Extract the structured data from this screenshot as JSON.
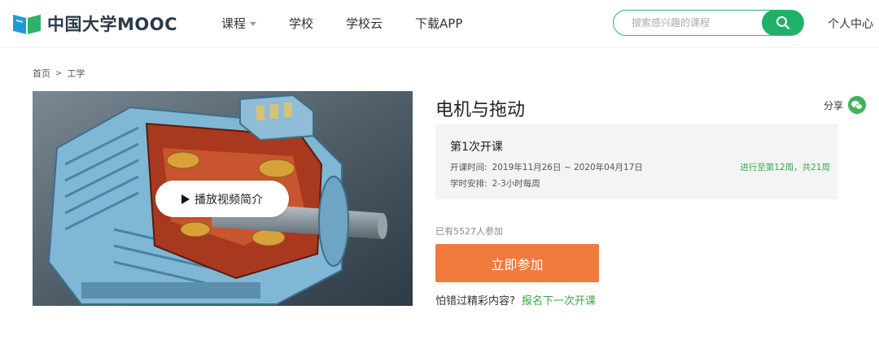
{
  "header": {
    "logo_text": "中国大学MOOC",
    "nav": [
      {
        "label": "课程",
        "has_dropdown": true
      },
      {
        "label": "学校"
      },
      {
        "label": "学校云"
      },
      {
        "label": "下载APP"
      }
    ],
    "search_placeholder": "搜索感兴趣的课程",
    "user_center": "个人中心"
  },
  "breadcrumb": {
    "home": "首页",
    "separator": ">",
    "category": "工学"
  },
  "video": {
    "play_label": "播放视频简介"
  },
  "course": {
    "title": "电机与拖动",
    "share_label": "分享",
    "term": {
      "title": "第1次开课",
      "time_key": "开课时间:",
      "time_value": "2019年11月26日 ~ 2020年04月17日",
      "schedule_key": "学时安排:",
      "schedule_value": "2-3小时每周",
      "progress": "进行至第12周，共21周"
    },
    "participants": "已有5527人参加",
    "join_label": "立即参加",
    "missed_text": "怕错过精彩内容?",
    "enroll_next_label": "报名下一次开课"
  },
  "colors": {
    "brand_green": "#21b068",
    "progress_green": "#39a84a",
    "join_orange": "#f07a3c"
  }
}
